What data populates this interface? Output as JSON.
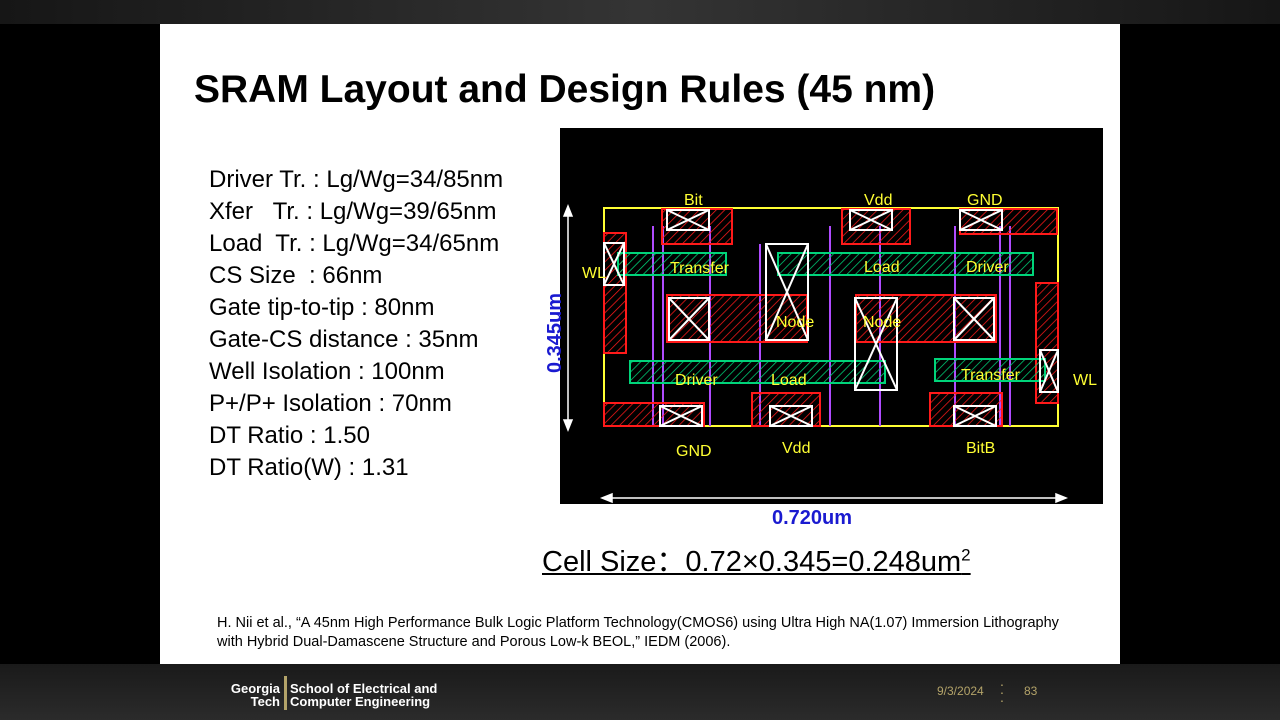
{
  "slide": {
    "title": "SRAM Layout and Design Rules (45 nm)",
    "specs": [
      "Driver Tr. : Lg/Wg=34/85nm",
      "Xfer   Tr. : Lg/Wg=39/65nm",
      "Load  Tr. : Lg/Wg=34/65nm",
      "CS Size  : 66nm",
      "Gate tip-to-tip : 80nm",
      "Gate-CS distance : 35nm",
      "Well Isolation : 100nm",
      "P+/P+ Isolation : 70nm",
      "DT Ratio : 1.50",
      "DT Ratio(W) : 1.31"
    ],
    "layout_labels": {
      "bit": "Bit",
      "vdd_top": "Vdd",
      "gnd_top": "GND",
      "wl_left": "WL",
      "wl_right": "WL",
      "transfer_top": "Transfer",
      "load_top": "Load",
      "driver_top": "Driver",
      "node_left": "Node",
      "node_right": "Node",
      "driver_bottom": "Driver",
      "load_bottom": "Load",
      "transfer_bottom": "Transfer",
      "gnd_bottom": "GND",
      "vdd_bottom": "Vdd",
      "bitb": "BitB"
    },
    "dim_width": "0.720um",
    "dim_height": "0.345um",
    "cell_size_text": "Cell Size：0.72×0.345=0.248um",
    "cell_size_sup": "2",
    "citation": "H. Nii et al., “A 45nm High Performance Bulk Logic Platform Technology(CMOS6) using Ultra High NA(1.07) Immersion Lithography with Hybrid Dual-Damascene Structure and Porous Low-k BEOL,” IEDM (2006)."
  },
  "footer": {
    "logo_line1": "Georgia",
    "logo_line2": "Tech",
    "school_line1": "School of Electrical and",
    "school_line2": "Computer Engineering",
    "date": "9/3/2024",
    "page_number": "83"
  },
  "colors": {
    "accent_gold": "#b3a369",
    "dimension_blue": "#1a1ad0",
    "layout_red": "#ff1a1a",
    "layout_green": "#00d47a",
    "layout_yellow": "#ffff33",
    "layout_purple": "#b04bff"
  }
}
